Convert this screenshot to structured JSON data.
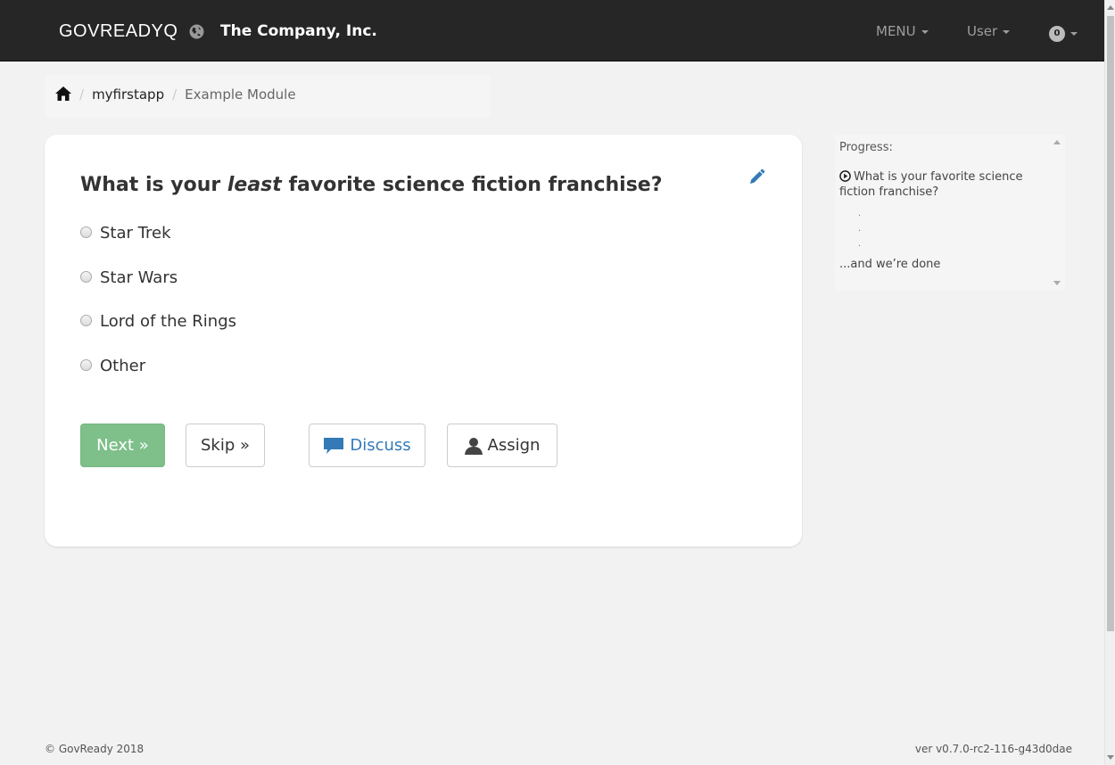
{
  "navbar": {
    "brand": "GOVREADYQ",
    "org_name": "The Company, Inc.",
    "menu_label": "MENU",
    "user_label": "User",
    "notification_count": "0"
  },
  "breadcrumb": {
    "items": [
      {
        "label": "myfirstapp"
      },
      {
        "label": "Example Module"
      }
    ]
  },
  "question": {
    "prefix": "What is your ",
    "emphasis": "least",
    "suffix": " favorite science fiction franchise?",
    "choices": [
      "Star Trek",
      "Star Wars",
      "Lord of the Rings",
      "Other"
    ]
  },
  "actions": {
    "next_label": "Next »",
    "skip_label": "Skip »",
    "discuss_label": "Discuss",
    "assign_label": "Assign"
  },
  "progress": {
    "title": "Progress:",
    "current_item": "What is your favorite science fiction franchise?",
    "dots": [
      ".",
      ".",
      "."
    ],
    "done_label": "...and we’re done"
  },
  "footer": {
    "copyright": "© GovReady 2018",
    "version": "ver v0.7.0-rc2-116-g43d0dae"
  },
  "colors": {
    "navbar_bg": "#262626",
    "next_button": "#7ebf8a",
    "link_blue": "#337ab7"
  }
}
